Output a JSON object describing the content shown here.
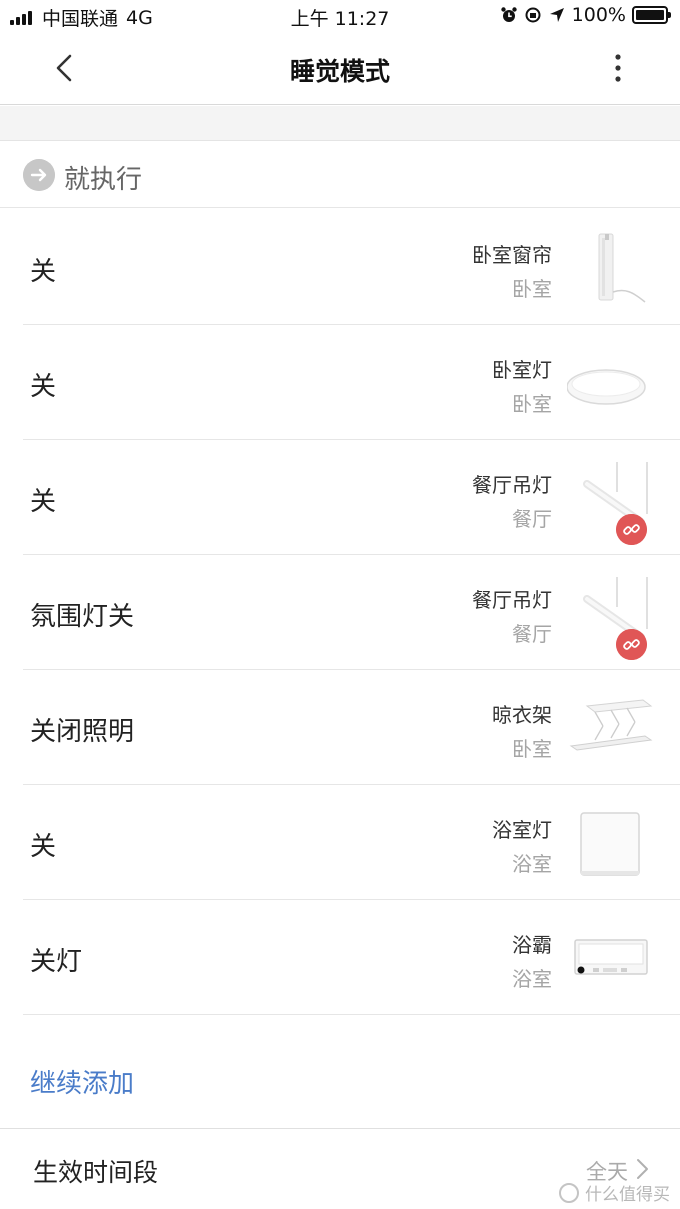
{
  "status_bar": {
    "carrier": "中国联通",
    "network": "4G",
    "time": "上午 11:27",
    "battery": "100%"
  },
  "nav": {
    "title": "睡觉模式",
    "back_icon": "chevron-left-icon",
    "more_icon": "more-vertical-icon"
  },
  "exec_header": {
    "label": "就执行",
    "icon": "arrow-right-circle-icon"
  },
  "actions": [
    {
      "action": "关",
      "device": "卧室窗帘",
      "room": "卧室",
      "thumb": "curtain-motor",
      "offline": false
    },
    {
      "action": "关",
      "device": "卧室灯",
      "room": "卧室",
      "thumb": "ceiling-light",
      "offline": false
    },
    {
      "action": "关",
      "device": "餐厅吊灯",
      "room": "餐厅",
      "thumb": "pendant-light",
      "offline": true
    },
    {
      "action": "氛围灯关",
      "device": "餐厅吊灯",
      "room": "餐厅",
      "thumb": "pendant-light",
      "offline": true
    },
    {
      "action": "关闭照明",
      "device": "晾衣架",
      "room": "卧室",
      "thumb": "clothes-rack",
      "offline": false
    },
    {
      "action": "关",
      "device": "浴室灯",
      "room": "浴室",
      "thumb": "square-panel-light",
      "offline": false
    },
    {
      "action": "关灯",
      "device": "浴霸",
      "room": "浴室",
      "thumb": "bath-heater",
      "offline": false
    }
  ],
  "add_more": "继续添加",
  "time_row": {
    "label": "生效时间段",
    "value": "全天"
  },
  "watermark": "什么值得买",
  "colors": {
    "link": "#4a7cc9",
    "offline_badge": "#e05656",
    "secondary_text": "#a5a5a5"
  }
}
